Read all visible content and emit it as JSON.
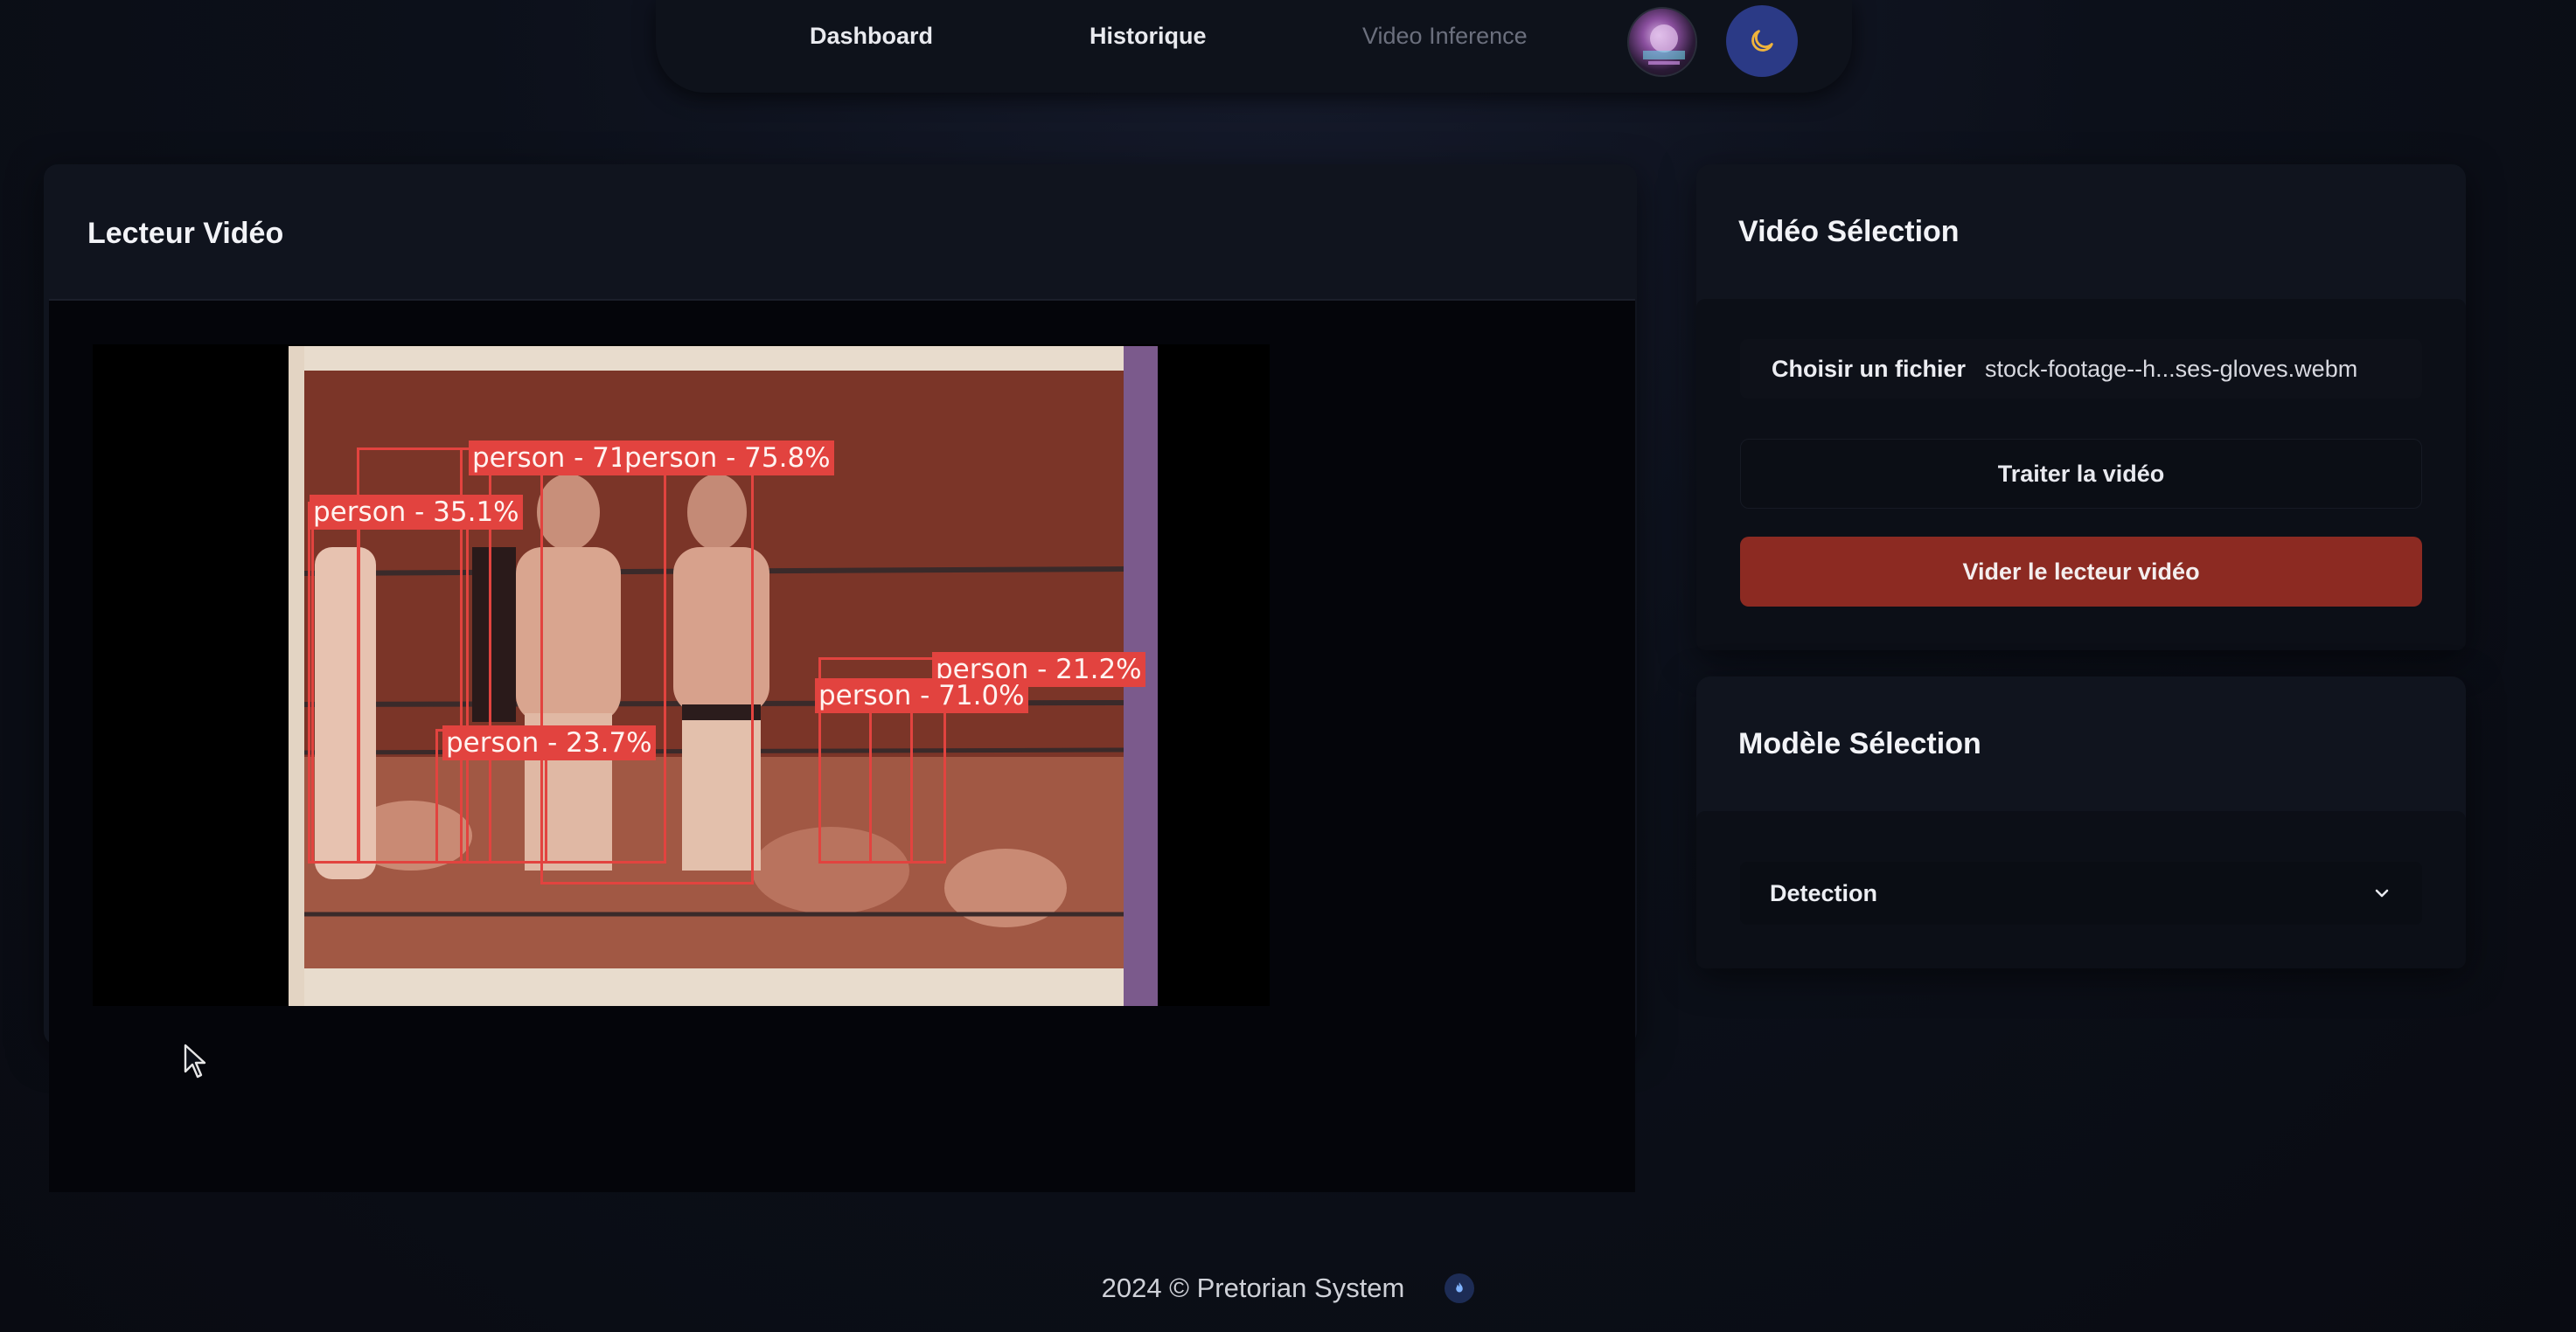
{
  "nav": {
    "links": [
      "Dashboard",
      "Historique",
      "Video Inference"
    ]
  },
  "video_panel": {
    "title": "Lecteur Vidéo",
    "detections": [
      {
        "label": "person - 71.5%"
      },
      {
        "label": "person - 75.8%"
      },
      {
        "label": "person - 35.1%"
      },
      {
        "label": "person - 21.2%"
      },
      {
        "label": "person - 71.0%"
      },
      {
        "label": "person - 23.7%"
      }
    ]
  },
  "video_select": {
    "title": "Vidéo Sélection",
    "choose_file_label": "Choisir un fichier",
    "file_name": "stock-footage--h...ses-gloves.webm",
    "process_button": "Traiter la vidéo",
    "clear_button": "Vider le lecteur vidéo"
  },
  "model_select": {
    "title": "Modèle Sélection",
    "selected": "Detection"
  },
  "footer": {
    "text": "2024 © Pretorian System"
  },
  "colors": {
    "clear_button": "#8c2a22",
    "theme_button": "#2b3a86",
    "detection": "#e2433f"
  }
}
